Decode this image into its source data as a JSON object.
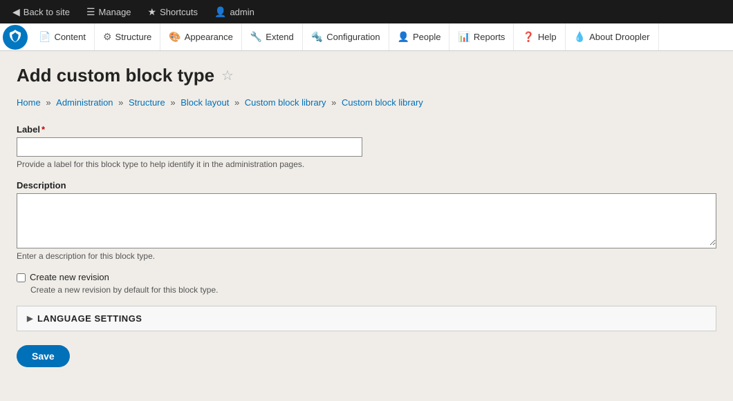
{
  "admin_bar": {
    "back_to_site": "Back to site",
    "manage": "Manage",
    "shortcuts": "Shortcuts",
    "admin": "admin"
  },
  "secondary_nav": {
    "items": [
      {
        "label": "Content",
        "icon": "📄"
      },
      {
        "label": "Structure",
        "icon": "⚙"
      },
      {
        "label": "Appearance",
        "icon": "🎨"
      },
      {
        "label": "Extend",
        "icon": "🔧"
      },
      {
        "label": "Configuration",
        "icon": "🔩"
      },
      {
        "label": "People",
        "icon": "👤"
      },
      {
        "label": "Reports",
        "icon": "📊"
      },
      {
        "label": "Help",
        "icon": "❓"
      },
      {
        "label": "About Droopler",
        "icon": "💧"
      }
    ]
  },
  "page": {
    "title": "Add custom block type",
    "breadcrumb": [
      {
        "text": "Home",
        "href": "#"
      },
      {
        "text": "Administration",
        "href": "#"
      },
      {
        "text": "Structure",
        "href": "#"
      },
      {
        "text": "Block layout",
        "href": "#"
      },
      {
        "text": "Custom block library",
        "href": "#"
      },
      {
        "text": "Custom block library",
        "href": "#"
      }
    ],
    "form": {
      "label_label": "Label",
      "label_required": "*",
      "label_help": "Provide a label for this block type to help identify it in the administration pages.",
      "description_label": "Description",
      "description_help": "Enter a description for this block type.",
      "revision_label": "Create new revision",
      "revision_help": "Create a new revision by default for this block type.",
      "language_settings": "Language Settings",
      "save_button": "Save"
    }
  }
}
